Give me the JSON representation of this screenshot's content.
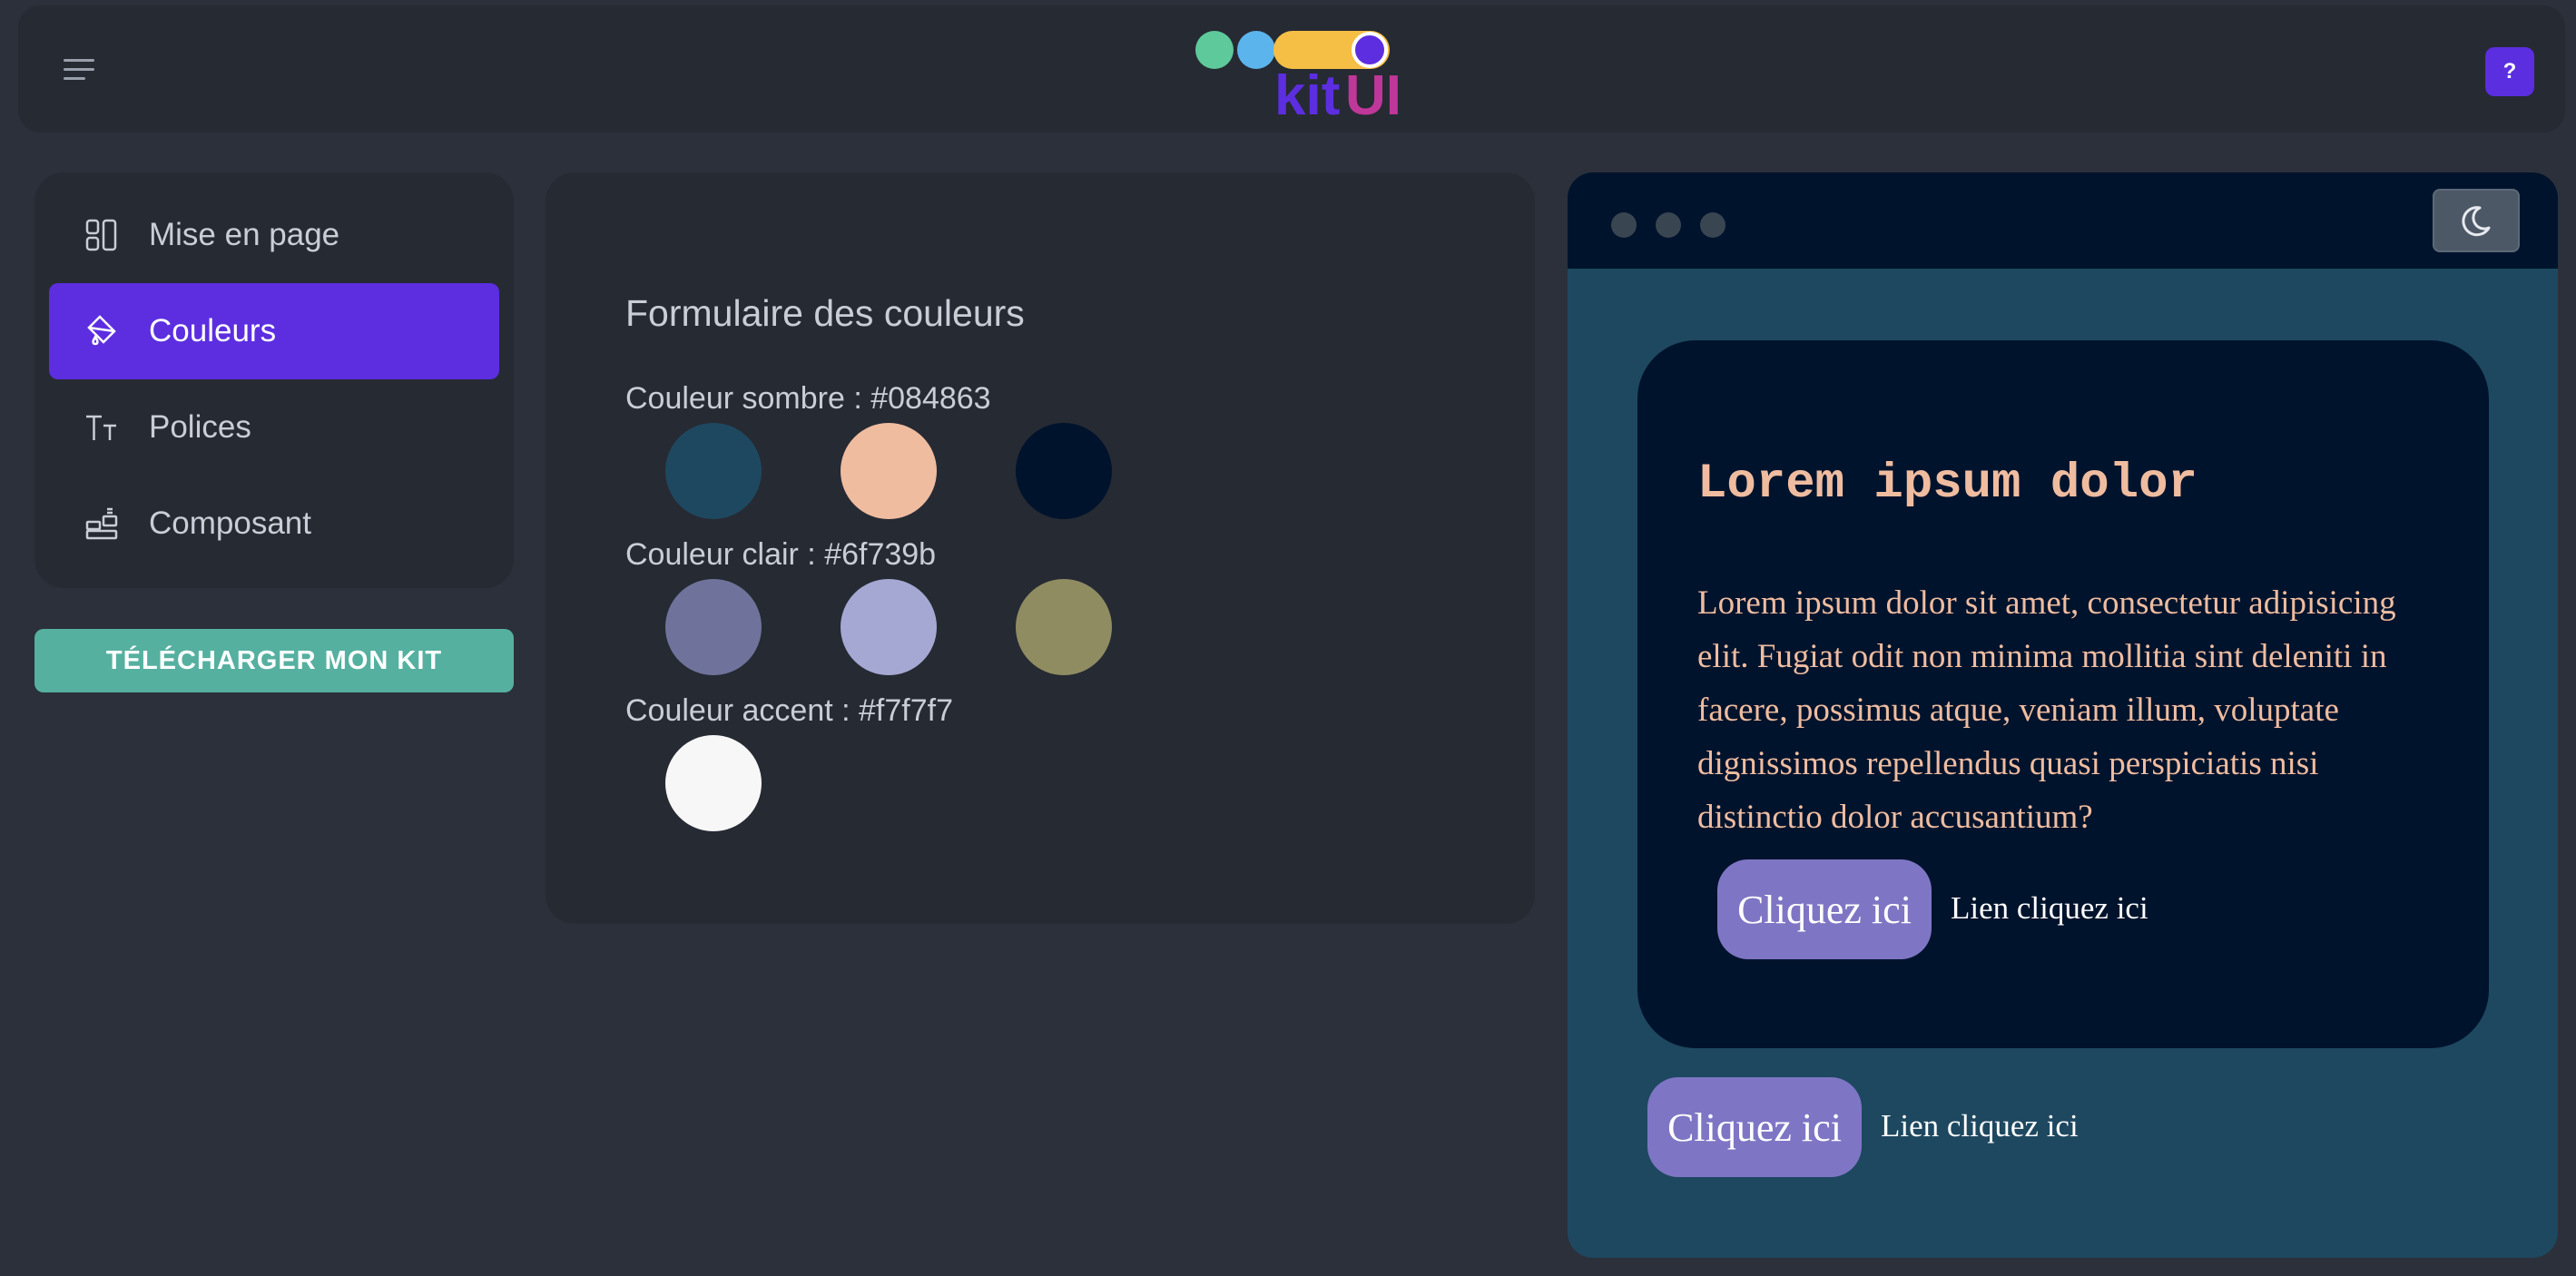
{
  "header": {
    "menu_icon": "hamburger-menu-icon",
    "logo_text": "kitUI",
    "help_label": "?"
  },
  "sidebar": {
    "items": [
      {
        "label": "Mise en page",
        "icon": "layout-icon",
        "active": false
      },
      {
        "label": "Couleurs",
        "icon": "paint-bucket-icon",
        "active": true
      },
      {
        "label": "Polices",
        "icon": "text-size-icon",
        "active": false
      },
      {
        "label": "Composant",
        "icon": "components-icon",
        "active": false
      }
    ],
    "download_label": "TÉLÉCHARGER MON KIT"
  },
  "colors_form": {
    "title": "Formulaire des couleurs",
    "groups": [
      {
        "label": "Couleur sombre : #084863",
        "swatches": [
          "#1e4860",
          "#efbca0",
          "#00132c"
        ]
      },
      {
        "label": "Couleur clair : #6f739b",
        "swatches": [
          "#6f739b",
          "#a5a8d2",
          "#8f8c62"
        ]
      },
      {
        "label": "Couleur accent : #f7f7f7",
        "swatches": [
          "#f7f7f7"
        ]
      }
    ]
  },
  "preview": {
    "theme_icon": "moon-icon",
    "card_title": "Lorem ipsum dolor",
    "card_text": "Lorem ipsum dolor sit amet, consectetur adipisicing elit. Fugiat odit non minima mollitia sint deleniti in facere, possimus atque, veniam illum, voluptate dignissimos repellendus quasi perspiciatis nisi distinctio dolor accusantium?",
    "card_button": "Cliquez ici",
    "card_link": "Lien cliquez ici",
    "outer_button": "Cliquez ici",
    "outer_link": "Lien cliquez ici"
  },
  "colors": {
    "accent": "#5c2ee0",
    "download": "#55b0a0",
    "dark": "#084863",
    "light": "#6f739b",
    "accent_color": "#f7f7f7"
  }
}
